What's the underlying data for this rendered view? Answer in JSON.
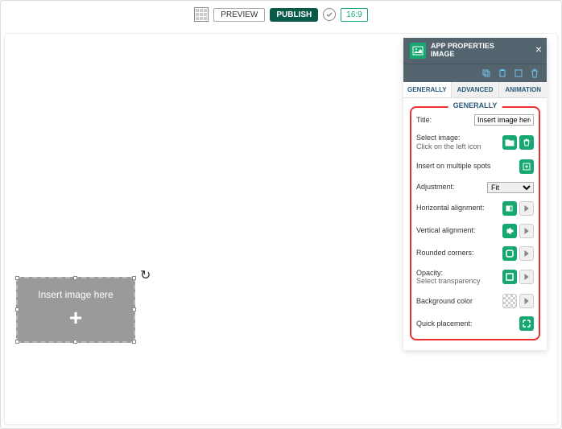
{
  "toolbar": {
    "preview": "PREVIEW",
    "publish": "PUBLISH",
    "ratio": "16:9"
  },
  "widget": {
    "label": "Insert image here"
  },
  "panel": {
    "title1": "APP PROPERTIES",
    "title2": "IMAGE",
    "tabs": {
      "generally": "GENERALLY",
      "advanced": "ADVANCED",
      "animation": "ANIMATION"
    },
    "section_title": "GENERALLY",
    "rows": {
      "title_label": "Title:",
      "title_value": "Insert image here",
      "select_image": "Select image:",
      "select_image_sub": "Click on the left icon",
      "multi_spots": "Insert on multiple spots",
      "adjustment": "Adjustment:",
      "adjustment_value": "Fit",
      "h_align": "Horizontal alignment:",
      "v_align": "Vertical alignment:",
      "rounded": "Rounded corners:",
      "opacity": "Opacity:",
      "opacity_sub": "Select transparency",
      "bg_color": "Background color",
      "quick": "Quick placement:"
    }
  }
}
